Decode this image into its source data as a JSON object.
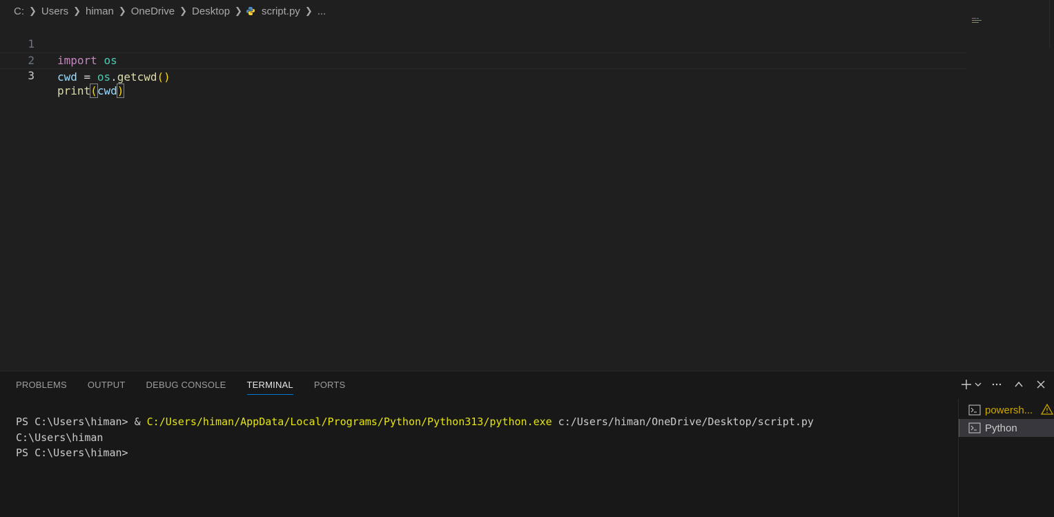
{
  "breadcrumb": [
    "C:",
    "Users",
    "himan",
    "OneDrive",
    "Desktop",
    "script.py",
    "..."
  ],
  "editor": {
    "line_numbers": [
      "1",
      "2",
      "3"
    ],
    "active_line": 3,
    "lines": [
      {
        "tokens": [
          "import",
          " ",
          "os"
        ]
      },
      {
        "tokens": [
          "cwd",
          " = ",
          "os",
          ".",
          "getcwd",
          "(",
          ")"
        ]
      },
      {
        "tokens": [
          "print",
          "(",
          "cwd",
          ")"
        ]
      }
    ]
  },
  "panel": {
    "tabs": [
      "PROBLEMS",
      "OUTPUT",
      "DEBUG CONSOLE",
      "TERMINAL",
      "PORTS"
    ],
    "active_tab": "TERMINAL",
    "terminal_lines": {
      "l1_prompt": "PS C:\\Users\\himan> ",
      "l1_amp": "& ",
      "l1_exe": "C:/Users/himan/AppData/Local/Programs/Python/Python313/python.exe",
      "l1_arg": " c:/Users/himan/OneDrive/Desktop/script.py",
      "l2": "C:\\Users\\himan",
      "l3": "PS C:\\Users\\himan>"
    },
    "terminals": [
      "powersh...",
      "Python"
    ]
  },
  "colors": {
    "keyword": "#c586c0",
    "module": "#4ec9b0",
    "variable": "#9cdcfe",
    "function": "#dcdcaa",
    "bracket": "#ffd700",
    "accent": "#0078d4",
    "terminal_command": "#e5e510",
    "warning": "#cca700"
  },
  "icons": [
    "chevron-right-icon",
    "python-file-icon",
    "add-terminal-icon",
    "chevron-down-icon",
    "more-icon",
    "maximize-icon",
    "close-icon",
    "terminal-icon",
    "warning-icon"
  ]
}
